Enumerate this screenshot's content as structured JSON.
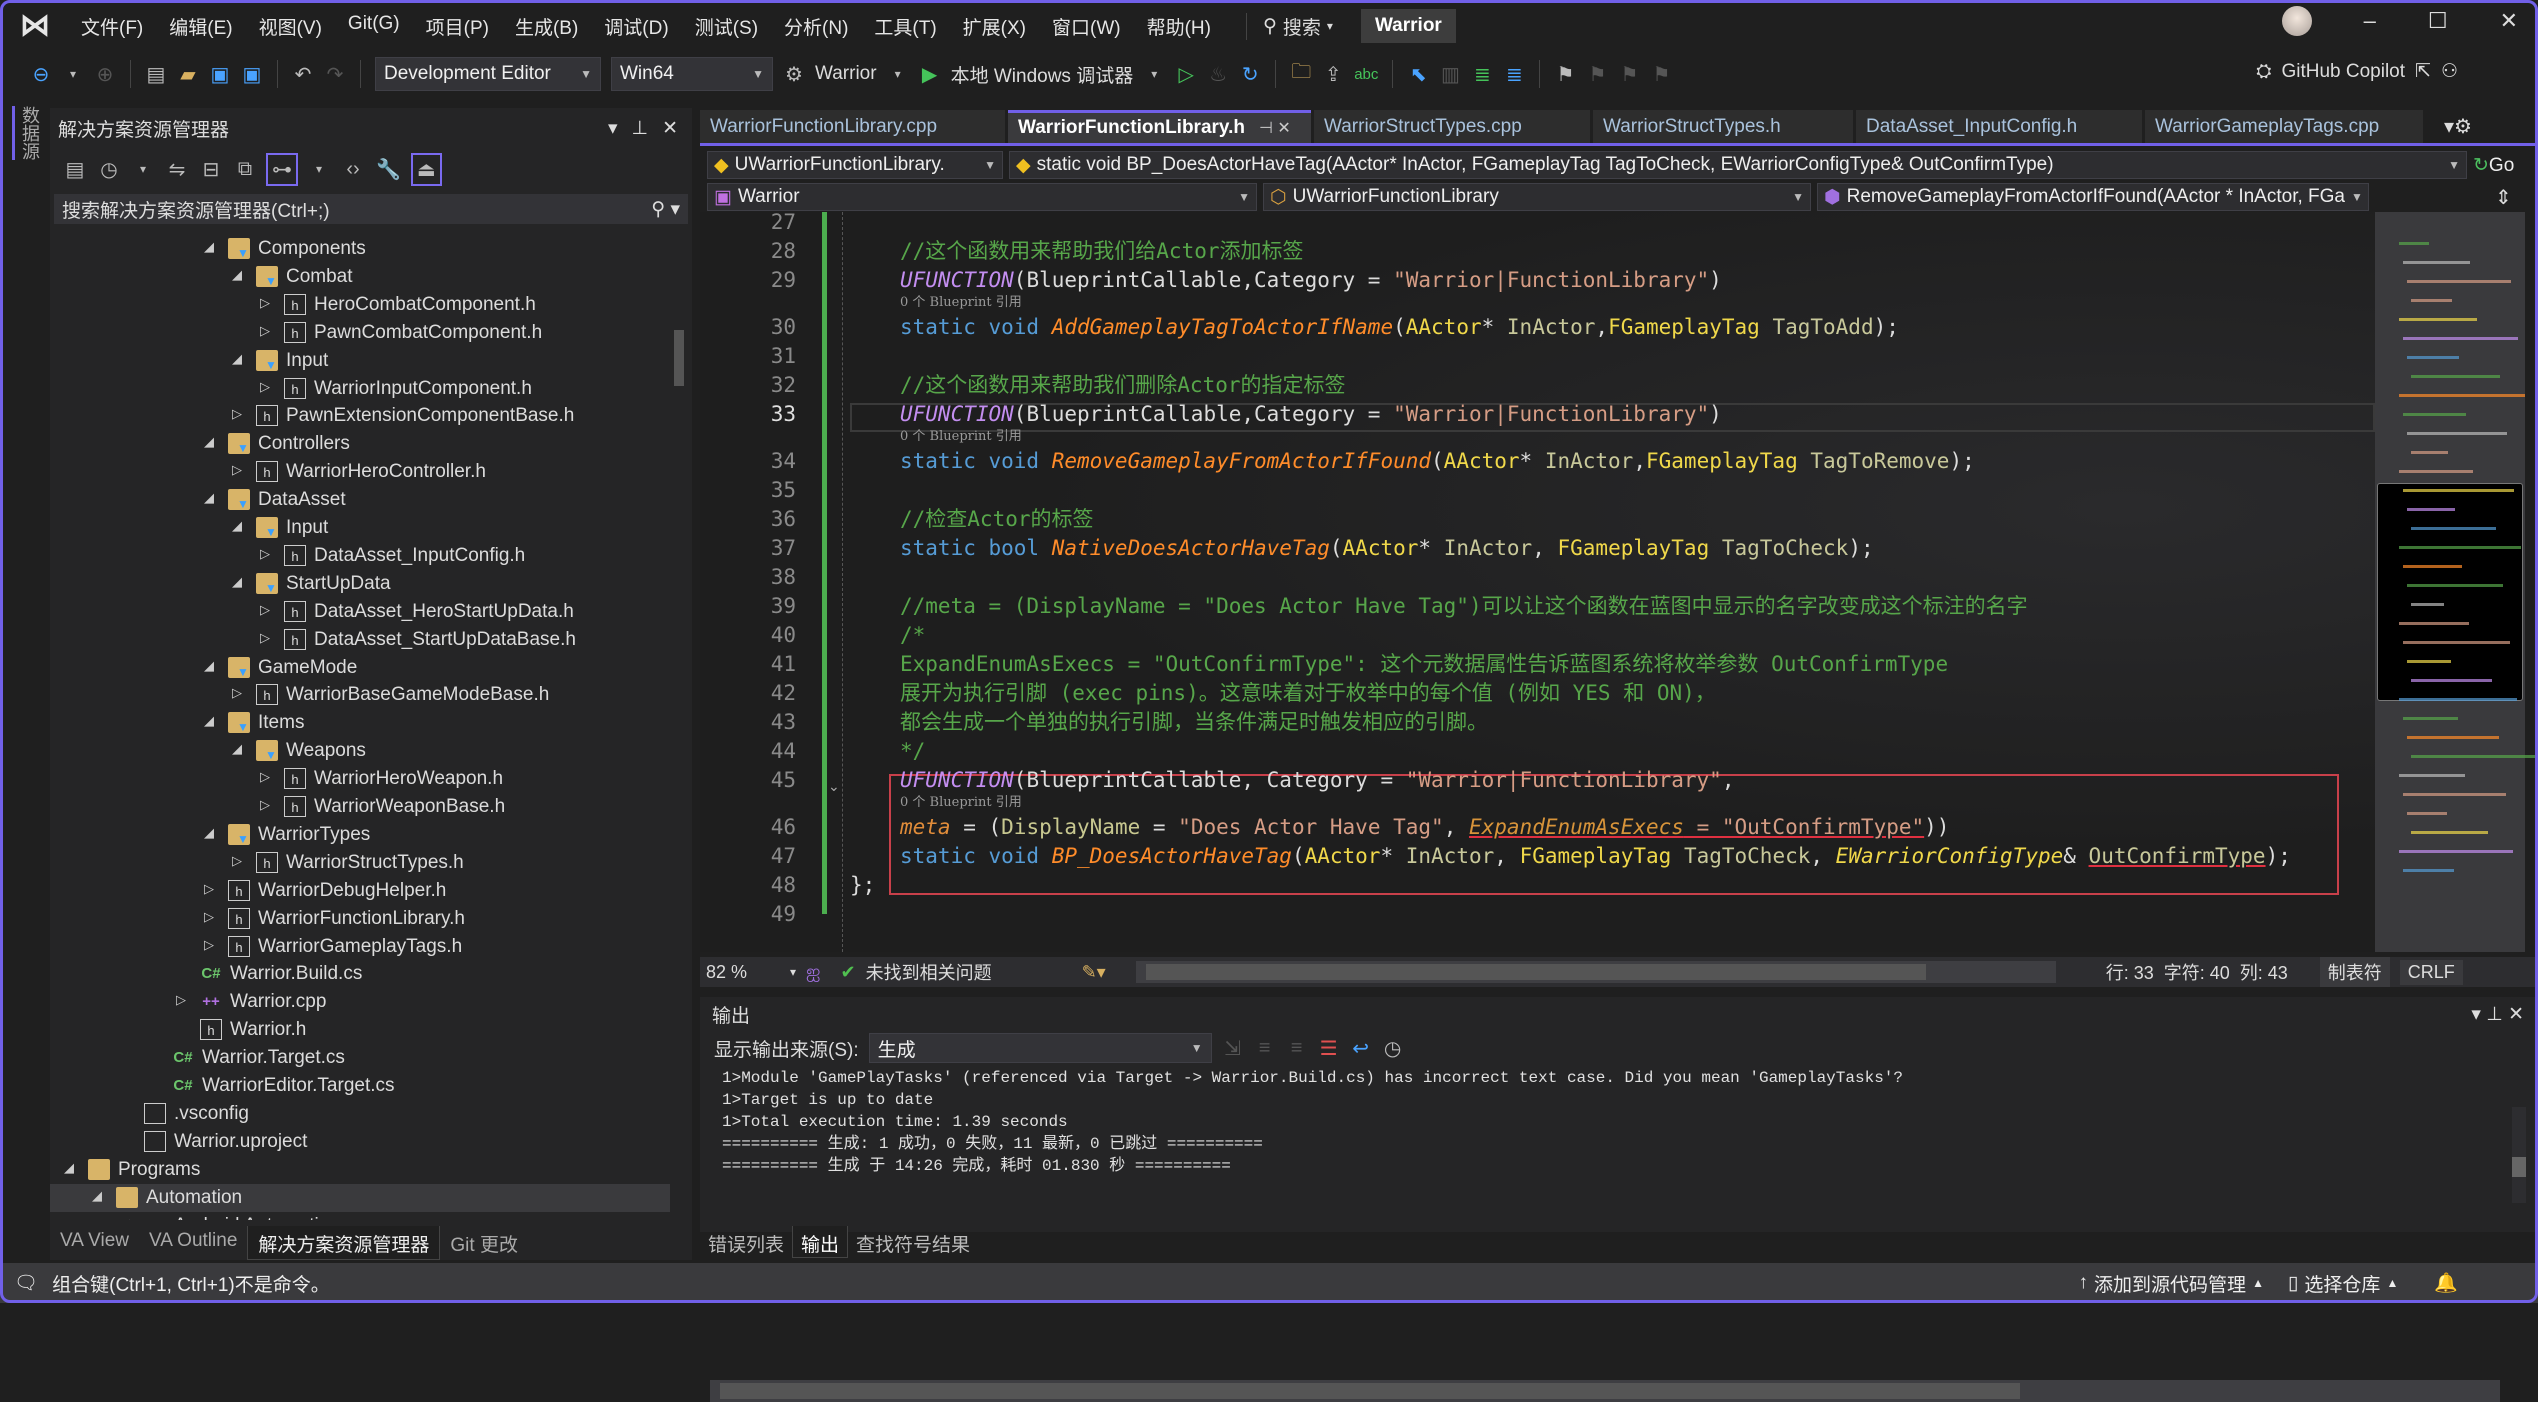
{
  "titlebar": {
    "menu": [
      "文件(F)",
      "编辑(E)",
      "视图(V)",
      "Git(G)",
      "项目(P)",
      "生成(B)",
      "调试(D)",
      "测试(S)",
      "分析(N)",
      "工具(T)",
      "扩展(X)",
      "窗口(W)",
      "帮助(H)"
    ],
    "search_label": "搜索",
    "project_name": "Warrior"
  },
  "toolbar": {
    "configuration": "Development Editor",
    "platform": "Win64",
    "startup_project": "Warrior",
    "debugger": "本地 Windows 调试器",
    "copilot": "GitHub Copilot"
  },
  "leftstrip": {
    "label": "数据源"
  },
  "solution_explorer": {
    "title": "解决方案资源管理器",
    "search_placeholder": "搜索解决方案资源管理器(Ctrl+;)",
    "items": [
      {
        "label": "Components",
        "level": 0,
        "icon": "folder-filter",
        "exp": "open"
      },
      {
        "label": "Combat",
        "level": 1,
        "icon": "folder-filter",
        "exp": "open"
      },
      {
        "label": "HeroCombatComponent.h",
        "level": 2,
        "icon": "header",
        "exp": "closed"
      },
      {
        "label": "PawnCombatComponent.h",
        "level": 2,
        "icon": "header",
        "exp": "closed"
      },
      {
        "label": "Input",
        "level": 1,
        "icon": "folder-filter",
        "exp": "open"
      },
      {
        "label": "WarriorInputComponent.h",
        "level": 2,
        "icon": "header",
        "exp": "closed"
      },
      {
        "label": "PawnExtensionComponentBase.h",
        "level": 1,
        "icon": "header",
        "exp": "closed"
      },
      {
        "label": "Controllers",
        "level": 0,
        "icon": "folder-filter",
        "exp": "open"
      },
      {
        "label": "WarriorHeroController.h",
        "level": 1,
        "icon": "header",
        "exp": "closed"
      },
      {
        "label": "DataAsset",
        "level": 0,
        "icon": "folder-filter",
        "exp": "open"
      },
      {
        "label": "Input",
        "level": 1,
        "icon": "folder-filter",
        "exp": "open"
      },
      {
        "label": "DataAsset_InputConfig.h",
        "level": 2,
        "icon": "header",
        "exp": "closed"
      },
      {
        "label": "StartUpData",
        "level": 1,
        "icon": "folder-filter",
        "exp": "open"
      },
      {
        "label": "DataAsset_HeroStartUpData.h",
        "level": 2,
        "icon": "header",
        "exp": "closed"
      },
      {
        "label": "DataAsset_StartUpDataBase.h",
        "level": 2,
        "icon": "header",
        "exp": "closed"
      },
      {
        "label": "GameMode",
        "level": 0,
        "icon": "folder-filter",
        "exp": "open"
      },
      {
        "label": "WarriorBaseGameModeBase.h",
        "level": 1,
        "icon": "header",
        "exp": "closed"
      },
      {
        "label": "Items",
        "level": 0,
        "icon": "folder-filter",
        "exp": "open"
      },
      {
        "label": "Weapons",
        "level": 1,
        "icon": "folder-filter",
        "exp": "open"
      },
      {
        "label": "WarriorHeroWeapon.h",
        "level": 2,
        "icon": "header",
        "exp": "closed"
      },
      {
        "label": "WarriorWeaponBase.h",
        "level": 2,
        "icon": "header",
        "exp": "closed"
      },
      {
        "label": "WarriorTypes",
        "level": 0,
        "icon": "folder-filter",
        "exp": "open"
      },
      {
        "label": "WarriorStructTypes.h",
        "level": 1,
        "icon": "header",
        "exp": "closed"
      },
      {
        "label": "WarriorDebugHelper.h",
        "level": 0,
        "icon": "header",
        "exp": "closed"
      },
      {
        "label": "WarriorFunctionLibrary.h",
        "level": 0,
        "icon": "header",
        "exp": "closed"
      },
      {
        "label": "WarriorGameplayTags.h",
        "level": 0,
        "icon": "header",
        "exp": "closed"
      },
      {
        "label": "Warrior.Build.cs",
        "level": -1,
        "icon": "cs",
        "exp": "none"
      },
      {
        "label": "Warrior.cpp",
        "level": -1,
        "icon": "cpp",
        "exp": "closed"
      },
      {
        "label": "Warrior.h",
        "level": -1,
        "icon": "header",
        "exp": "none"
      },
      {
        "label": "Warrior.Target.cs",
        "level": -2,
        "icon": "cs",
        "exp": "none"
      },
      {
        "label": "WarriorEditor.Target.cs",
        "level": -2,
        "icon": "cs",
        "exp": "none"
      },
      {
        "label": ".vsconfig",
        "level": -3,
        "icon": "file",
        "exp": "none"
      },
      {
        "label": "Warrior.uproject",
        "level": -3,
        "icon": "file",
        "exp": "none"
      },
      {
        "label": "Programs",
        "level": -5,
        "icon": "folder",
        "exp": "open"
      },
      {
        "label": "Automation",
        "level": -4,
        "icon": "folder",
        "exp": "open",
        "selected": true
      },
      {
        "label": "Android Automation",
        "level": -3,
        "icon": "cs",
        "exp": "open"
      }
    ],
    "bottom_tabs": [
      "VA View",
      "VA Outline",
      "解决方案资源管理器",
      "Git 更改"
    ]
  },
  "editor": {
    "tabs": [
      "WarriorFunctionLibrary.cpp",
      "WarriorFunctionLibrary.h",
      "WarriorStructTypes.cpp",
      "WarriorStructTypes.h",
      "DataAsset_InputConfig.h",
      "WarriorGameplayTags.cpp"
    ],
    "active_tab": 1,
    "nav_scope": "UWarriorFunctionLibrary.",
    "nav_symbol": "static void BP_DoesActorHaveTag(AActor* InActor, FGameplayTag TagToCheck, EWarriorConfigType& OutConfirmType)",
    "nav_go": "Go",
    "nav_project": "Warrior",
    "nav_class": "UWarriorFunctionLibrary",
    "nav_member": "RemoveGameplayFromActorIfFound(AActor * InActor, FGa",
    "codelens": "0 个 Blueprint 引用",
    "current_line": 33,
    "lines": [
      {
        "n": "27",
        "t": []
      },
      {
        "n": "28",
        "t": [
          [
            "cm",
            "//这个函数用来帮助我们给Actor添加标签"
          ]
        ]
      },
      {
        "n": "29",
        "lens": true,
        "t": [
          [
            "mac",
            "UFUNCTION"
          ],
          [
            "tx",
            "(BlueprintCallable,Category = "
          ],
          [
            "st",
            "\"Warrior|FunctionLibrary\""
          ],
          [
            "tx",
            ")"
          ]
        ]
      },
      {
        "n": "30",
        "t": [
          [
            "kw",
            "static void "
          ],
          [
            "fn",
            "AddGameplayTagToActorIfName"
          ],
          [
            "tx",
            "("
          ],
          [
            "ty",
            "AActor"
          ],
          [
            "tx",
            "* "
          ],
          [
            "pa",
            "InActor"
          ],
          [
            "tx",
            ","
          ],
          [
            "ty",
            "FGameplayTag"
          ],
          [
            "tx",
            " "
          ],
          [
            "pa",
            "TagToAdd"
          ],
          [
            "tx",
            ");"
          ]
        ]
      },
      {
        "n": "31",
        "t": []
      },
      {
        "n": "32",
        "t": [
          [
            "cm",
            "//这个函数用来帮助我们删除Actor的指定标签"
          ]
        ]
      },
      {
        "n": "33",
        "lens": true,
        "t": [
          [
            "mac",
            "UFUNCTION"
          ],
          [
            "tx",
            "(BlueprintCallable,Category = "
          ],
          [
            "st",
            "\"Warrior|FunctionLibrary\""
          ],
          [
            "tx",
            ")"
          ]
        ]
      },
      {
        "n": "34",
        "t": [
          [
            "kw",
            "static void "
          ],
          [
            "fn",
            "RemoveGameplayFromActorIfFound"
          ],
          [
            "tx",
            "("
          ],
          [
            "ty",
            "AActor"
          ],
          [
            "tx",
            "* "
          ],
          [
            "pa",
            "InActor"
          ],
          [
            "tx",
            ","
          ],
          [
            "ty",
            "FGameplayTag"
          ],
          [
            "tx",
            " "
          ],
          [
            "pa",
            "TagToRemove"
          ],
          [
            "tx",
            ");"
          ]
        ]
      },
      {
        "n": "35",
        "t": []
      },
      {
        "n": "36",
        "t": [
          [
            "cm",
            "//检查Actor的标签"
          ]
        ]
      },
      {
        "n": "37",
        "t": [
          [
            "kw",
            "static bool "
          ],
          [
            "fn",
            "NativeDoesActorHaveTag"
          ],
          [
            "tx",
            "("
          ],
          [
            "ty",
            "AActor"
          ],
          [
            "tx",
            "* "
          ],
          [
            "pa",
            "InActor"
          ],
          [
            "tx",
            ", "
          ],
          [
            "ty",
            "FGameplayTag"
          ],
          [
            "tx",
            " "
          ],
          [
            "pa",
            "TagToCheck"
          ],
          [
            "tx",
            ");"
          ]
        ]
      },
      {
        "n": "38",
        "t": []
      },
      {
        "n": "39",
        "t": [
          [
            "cm",
            "//meta = (DisplayName = \"Does Actor Have Tag\")可以让这个函数在蓝图中显示的名字改变成这个标注的名字"
          ]
        ]
      },
      {
        "n": "40",
        "t": [
          [
            "cm",
            "/*"
          ]
        ]
      },
      {
        "n": "41",
        "t": [
          [
            "cm",
            "ExpandEnumAsExecs = \"OutConfirmType\": 这个元数据属性告诉蓝图系统将枚举参数 OutConfirmType"
          ]
        ]
      },
      {
        "n": "42",
        "t": [
          [
            "cm",
            "展开为执行引脚 (exec pins)。这意味着对于枚举中的每个值 (例如 YES 和 ON)，"
          ]
        ]
      },
      {
        "n": "43",
        "t": [
          [
            "cm",
            "都会生成一个单独的执行引脚，当条件满足时触发相应的引脚。"
          ]
        ]
      },
      {
        "n": "44",
        "t": [
          [
            "cm",
            "*/"
          ]
        ]
      },
      {
        "n": "45",
        "lens": true,
        "t": [
          [
            "mac",
            "UFUNCTION"
          ],
          [
            "tx",
            "(BlueprintCallable, Category = "
          ],
          [
            "st",
            "\"Warrior|FunctionLibrary\""
          ],
          [
            "tx",
            ","
          ]
        ]
      },
      {
        "n": "46",
        "t": [
          [
            "me",
            "meta"
          ],
          [
            "tx",
            " = ("
          ],
          [
            "dn",
            "DisplayName"
          ],
          [
            "tx",
            " = "
          ],
          [
            "st",
            "\"Does Actor Have Tag\""
          ],
          [
            "tx",
            ", "
          ],
          [
            "ex",
            "ExpandEnumAsExecs"
          ],
          [
            "stu",
            " = \"OutConfirmType\""
          ],
          [
            "tx",
            "))"
          ]
        ]
      },
      {
        "n": "47",
        "t": [
          [
            "kw",
            "static void "
          ],
          [
            "fn",
            "BP_DoesActorHaveTag"
          ],
          [
            "tx",
            "("
          ],
          [
            "ty",
            "AActor"
          ],
          [
            "tx",
            "* "
          ],
          [
            "pa",
            "InActor"
          ],
          [
            "tx",
            ", "
          ],
          [
            "ty",
            "FGameplayTag"
          ],
          [
            "tx",
            " "
          ],
          [
            "pa",
            "TagToCheck"
          ],
          [
            "tx",
            ", "
          ],
          [
            "tyi",
            "EWarriorConfigType"
          ],
          [
            "tx",
            "& "
          ],
          [
            "pau",
            "OutConfirmType"
          ],
          [
            "tx",
            ");"
          ]
        ]
      },
      {
        "n": "48",
        "indent": 0,
        "t": [
          [
            "tx",
            "};"
          ]
        ]
      },
      {
        "n": "49",
        "t": []
      }
    ],
    "status": {
      "zoom": "82 %",
      "issues": "未找到相关问题",
      "line": "行: 33",
      "char": "字符: 40",
      "col": "列: 43",
      "tabs": "制表符",
      "eol": "CRLF"
    }
  },
  "output": {
    "title": "输出",
    "source_label": "显示输出来源(S):",
    "source_value": "生成",
    "lines": [
      "1>Module 'GamePlayTasks' (referenced via Target -> Warrior.Build.cs) has incorrect text case. Did you mean 'GameplayTasks'?",
      "1>Target is up to date",
      "1>Total execution time: 1.39 seconds",
      "========== 生成: 1 成功，0 失败，11 最新，0 已跳过 ==========",
      "========== 生成 于 14:26 完成，耗时 01.830 秒 =========="
    ],
    "tabs": [
      "错误列表",
      "输出",
      "查找符号结果"
    ]
  },
  "statusbar": {
    "message": "组合键(Ctrl+1, Ctrl+1)不是命令。",
    "source_control": "添加到源代码管理",
    "repo": "选择仓库"
  },
  "colors": {
    "accent": "#7160e8",
    "change_bar": "#4cae4f",
    "error_box": "#c8404a",
    "comment": "#57a64a",
    "keyword": "#569cd6",
    "function": "#ff8c2a",
    "type": "#f0d84a",
    "string": "#d69d85"
  }
}
